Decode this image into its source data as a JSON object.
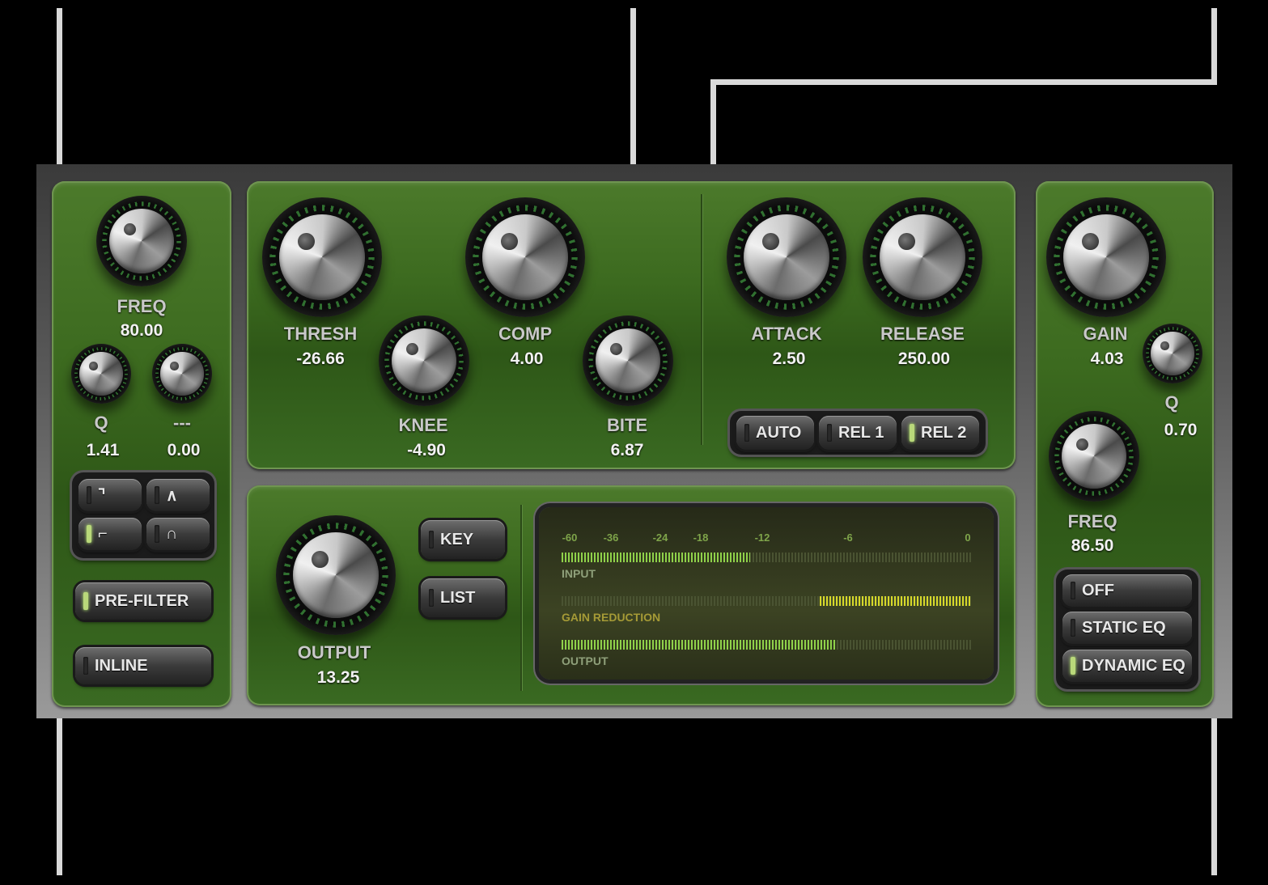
{
  "eq_left": {
    "freq": {
      "label": "FREQ",
      "value": "80.00"
    },
    "q": {
      "label": "Q",
      "value": "1.41"
    },
    "gain": {
      "label": "---",
      "value": "0.00"
    },
    "pre_filter_label": "PRE-FILTER",
    "inline_label": "INLINE"
  },
  "compressor": {
    "thresh": {
      "label": "THRESH",
      "value": "-26.66"
    },
    "knee": {
      "label": "KNEE",
      "value": "-4.90"
    },
    "comp": {
      "label": "COMP",
      "value": "4.00"
    },
    "bite": {
      "label": "BITE",
      "value": "6.87"
    },
    "attack": {
      "label": "ATTACK",
      "value": "2.50"
    },
    "release": {
      "label": "RELEASE",
      "value": "250.00"
    },
    "release_modes": [
      {
        "label": "AUTO",
        "active": false
      },
      {
        "label": "REL 1",
        "active": false
      },
      {
        "label": "REL 2",
        "active": true
      }
    ]
  },
  "output_section": {
    "output": {
      "label": "OUTPUT",
      "value": "13.25"
    },
    "key_label": "KEY",
    "list_label": "LIST"
  },
  "meters": {
    "scale": [
      "-60",
      "-36",
      "-24",
      "-18",
      "-12",
      "-6",
      "0"
    ],
    "input": {
      "label": "INPUT",
      "level": 0.46
    },
    "gain_reduction": {
      "label": "GAIN REDUCTION",
      "level": 0.37
    },
    "output": {
      "label": "OUTPUT",
      "level": 0.67
    }
  },
  "eq_right": {
    "gain": {
      "label": "GAIN",
      "value": "4.03"
    },
    "q": {
      "label": "Q",
      "value": "0.70"
    },
    "freq": {
      "label": "FREQ",
      "value": "86.50"
    },
    "modes": [
      {
        "label": "OFF",
        "active": false
      },
      {
        "label": "STATIC EQ",
        "active": false
      },
      {
        "label": "DYNAMIC EQ",
        "active": true
      }
    ]
  },
  "colors": {
    "panel_green": "#3c6a1f",
    "meter_green": "#8fd14a",
    "meter_yellow": "#d6d82a",
    "led_on": "#b9d87a"
  }
}
